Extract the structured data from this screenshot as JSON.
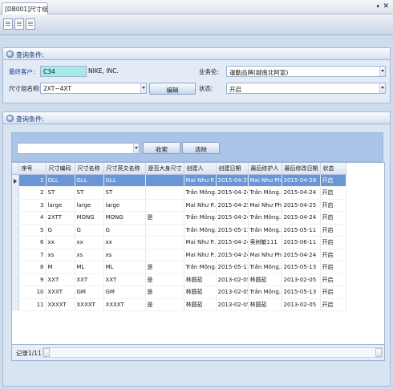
{
  "tab": {
    "title": "[DB001]尺寸组",
    "menu_glyph": "▾",
    "close_glyph": "✕"
  },
  "panel1": {
    "title": "查询条件:",
    "customer_label": "最终客户:",
    "customer_code": "C34",
    "customer_name": "NIKE, INC.",
    "size_group_label": "尺寸组名称:",
    "size_group_value": "2XT~4XT",
    "edit_button": "编辑",
    "business_label": "业务伦:",
    "business_value": "運動品牌(越南北阿富)",
    "status_label": "状态:",
    "status_value": "开启"
  },
  "panel2": {
    "title": "查询条件:",
    "search_value": "",
    "search_button": "收索",
    "clear_button": "清除"
  },
  "table": {
    "headers": [
      "序号",
      "尺寸编码",
      "尺寸名称",
      "尺寸英文名称",
      "是否大身尺寸",
      "创建人",
      "创建日期",
      "最后修护人",
      "最后修改日期",
      "状态"
    ],
    "rows": [
      [
        "1",
        "GLL",
        "GLL",
        "GLL",
        "",
        "Mai Như P...",
        "2015-04-25",
        "Mai Như Ph...",
        "2015-04-29",
        "开启"
      ],
      [
        "2",
        "ST",
        "ST",
        "ST",
        "",
        "Trần Mông...",
        "2015-04-24",
        "Trần Mông...",
        "2015-04-24",
        "开启"
      ],
      [
        "3",
        "large",
        "large",
        "large",
        "",
        "Mai Như P...",
        "2015-04-25",
        "Mai Như Ph...",
        "2015-04-25",
        "开启"
      ],
      [
        "4",
        "2XTT",
        "MONG",
        "MONG",
        "是",
        "Trần Mông...",
        "2015-04-24",
        "Trần Mông...",
        "2015-04-24",
        "开启"
      ],
      [
        "5",
        "G",
        "G",
        "G",
        "",
        "Trần Mông...",
        "2015-05-11",
        "Trần Mông...",
        "2015-05-11",
        "开启"
      ],
      [
        "6",
        "xx",
        "xx",
        "xx",
        "",
        "Mai Như P...",
        "2015-04-24",
        "吴树敏111",
        "2015-06-11",
        "开启"
      ],
      [
        "7",
        "xs",
        "xs",
        "xs",
        "",
        "Mai Như P...",
        "2015-04-24",
        "Mai Như Ph...",
        "2015-04-24",
        "开启"
      ],
      [
        "8",
        "M",
        "ML",
        "ML",
        "是",
        "Trần Mông...",
        "2015-05-11",
        "Trần Mông...",
        "2015-05-13",
        "开启"
      ],
      [
        "9",
        "XXT",
        "XXT",
        "XXT",
        "是",
        "林圆茹",
        "2013-02-05",
        "林圆茹",
        "2013-02-05",
        "开启"
      ],
      [
        "10",
        "XXXT",
        "GM",
        "GM",
        "是",
        "林圆茹",
        "2013-02-05",
        "Trần Mông...",
        "2015-05-13",
        "开启"
      ],
      [
        "11",
        "XXXXT",
        "XXXXT",
        "XXXXT",
        "是",
        "林圆茹",
        "2013-02-05",
        "林圆茹",
        "2013-02-05",
        "开启"
      ]
    ],
    "selected_row": 0
  },
  "footer": {
    "record_label": "记录1/11"
  },
  "colors": {
    "selected_row": "#6a96d6",
    "panel_bg": "#cfdcee",
    "search_bar": "#a9c4e6"
  }
}
